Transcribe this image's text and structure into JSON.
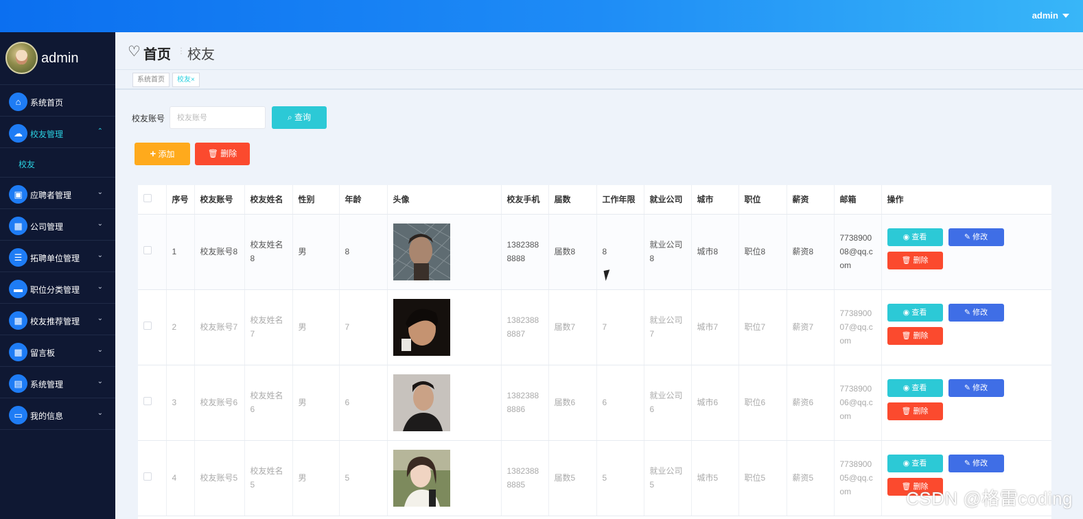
{
  "topbar": {
    "user": "admin"
  },
  "sidebar": {
    "profile_name": "admin",
    "items": [
      {
        "label": "系统首页",
        "icon": "home-icon",
        "glyph": "⌂",
        "expandable": false
      },
      {
        "label": "校友管理",
        "icon": "cloud-icon",
        "glyph": "☁",
        "expandable": true,
        "active": true
      },
      {
        "label": "应聘者管理",
        "icon": "briefcase-icon",
        "glyph": "▣",
        "expandable": true
      },
      {
        "label": "公司管理",
        "icon": "grid-icon",
        "glyph": "▦",
        "expandable": true
      },
      {
        "label": "拓聘单位管理",
        "icon": "list-icon",
        "glyph": "☰",
        "expandable": true
      },
      {
        "label": "职位分类管理",
        "icon": "ticket-icon",
        "glyph": "▬",
        "expandable": true
      },
      {
        "label": "校友推荐管理",
        "icon": "grid-icon",
        "glyph": "▦",
        "expandable": true
      },
      {
        "label": "留言板",
        "icon": "grid-icon",
        "glyph": "▦",
        "expandable": true
      },
      {
        "label": "系统管理",
        "icon": "clipboard-icon",
        "glyph": "▤",
        "expandable": true
      },
      {
        "label": "我的信息",
        "icon": "card-icon",
        "glyph": "▭",
        "expandable": true
      }
    ],
    "sub_item": "校友"
  },
  "breadcrumb": {
    "home": "首页",
    "current": "校友"
  },
  "tags": {
    "home": "系统首页",
    "current": "校友",
    "close": "×"
  },
  "search": {
    "label": "校友账号",
    "placeholder": "校友账号",
    "button": "查询"
  },
  "actions": {
    "add": "添加",
    "delete": "删除"
  },
  "table": {
    "headers": [
      "",
      "序号",
      "校友账号",
      "校友姓名",
      "性别",
      "年龄",
      "头像",
      "校友手机",
      "届数",
      "工作年限",
      "就业公司",
      "城市",
      "职位",
      "薪资",
      "邮箱",
      "操作"
    ],
    "op_labels": {
      "view": "查看",
      "edit": "修改",
      "delete": "删除"
    },
    "rows": [
      {
        "no": "1",
        "account": "校友账号8",
        "name": "校友姓名8",
        "gender": "男",
        "age": "8",
        "phone": "13823888888",
        "session": "届数8",
        "years": "8",
        "company": "就业公司8",
        "city": "城市8",
        "position": "职位8",
        "salary": "薪资8",
        "email": "773890008@qq.com"
      },
      {
        "no": "2",
        "account": "校友账号7",
        "name": "校友姓名7",
        "gender": "男",
        "age": "7",
        "phone": "13823888887",
        "session": "届数7",
        "years": "7",
        "company": "就业公司7",
        "city": "城市7",
        "position": "职位7",
        "salary": "薪资7",
        "email": "773890007@qq.com"
      },
      {
        "no": "3",
        "account": "校友账号6",
        "name": "校友姓名6",
        "gender": "男",
        "age": "6",
        "phone": "13823888886",
        "session": "届数6",
        "years": "6",
        "company": "就业公司6",
        "city": "城市6",
        "position": "职位6",
        "salary": "薪资6",
        "email": "773890006@qq.com"
      },
      {
        "no": "4",
        "account": "校友账号5",
        "name": "校友姓名5",
        "gender": "男",
        "age": "5",
        "phone": "13823888885",
        "session": "届数5",
        "years": "5",
        "company": "就业公司5",
        "city": "城市5",
        "position": "职位5",
        "salary": "薪资5",
        "email": "773890005@qq.com"
      }
    ]
  },
  "watermark": "CSDN @格雷coding",
  "colors": {
    "accent": "#2cc9d6",
    "primary": "#3f6ee6",
    "danger": "#fb4a2e",
    "warning": "#ffaa1c",
    "sidebar": "#0f1833"
  }
}
